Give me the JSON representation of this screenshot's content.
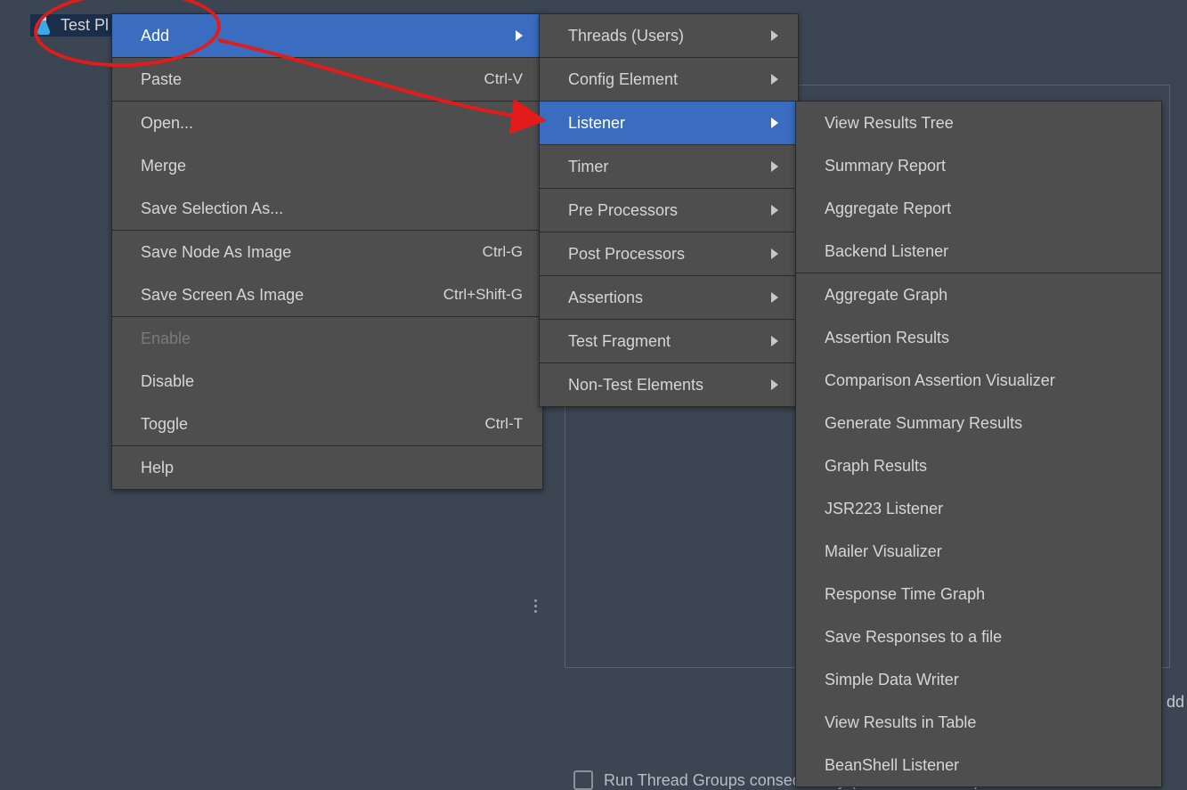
{
  "tree": {
    "item_label": "Test Pl"
  },
  "menu_main": [
    {
      "label": "Add",
      "shortcut": "",
      "submenu": true,
      "selected": true
    },
    {
      "sep": true
    },
    {
      "label": "Paste",
      "shortcut": "Ctrl-V"
    },
    {
      "sep": true
    },
    {
      "label": "Open..."
    },
    {
      "label": "Merge"
    },
    {
      "label": "Save Selection As..."
    },
    {
      "sep": true
    },
    {
      "label": "Save Node As Image",
      "shortcut": "Ctrl-G"
    },
    {
      "label": "Save Screen As Image",
      "shortcut": "Ctrl+Shift-G"
    },
    {
      "sep": true
    },
    {
      "label": "Enable",
      "disabled": true
    },
    {
      "label": "Disable"
    },
    {
      "label": "Toggle",
      "shortcut": "Ctrl-T"
    },
    {
      "sep": true
    },
    {
      "label": "Help"
    }
  ],
  "menu_add": [
    {
      "label": "Threads (Users)",
      "submenu": true
    },
    {
      "sep": true
    },
    {
      "label": "Config Element",
      "submenu": true
    },
    {
      "sep": true
    },
    {
      "label": "Listener",
      "submenu": true,
      "selected": true
    },
    {
      "sep": true
    },
    {
      "label": "Timer",
      "submenu": true
    },
    {
      "sep": true
    },
    {
      "label": "Pre Processors",
      "submenu": true
    },
    {
      "sep": true
    },
    {
      "label": "Post Processors",
      "submenu": true
    },
    {
      "sep": true
    },
    {
      "label": "Assertions",
      "submenu": true
    },
    {
      "sep": true
    },
    {
      "label": "Test Fragment",
      "submenu": true
    },
    {
      "sep": true
    },
    {
      "label": "Non-Test Elements",
      "submenu": true
    }
  ],
  "menu_listener": [
    {
      "label": "View Results Tree"
    },
    {
      "label": "Summary Report"
    },
    {
      "label": "Aggregate Report"
    },
    {
      "label": "Backend Listener"
    },
    {
      "sep": true
    },
    {
      "label": "Aggregate Graph"
    },
    {
      "label": "Assertion Results"
    },
    {
      "label": "Comparison Assertion Visualizer"
    },
    {
      "label": "Generate Summary Results"
    },
    {
      "label": "Graph Results"
    },
    {
      "label": "JSR223 Listener"
    },
    {
      "label": "Mailer Visualizer"
    },
    {
      "label": "Response Time Graph"
    },
    {
      "label": "Save Responses to a file"
    },
    {
      "label": "Simple Data Writer"
    },
    {
      "label": "View Results in Table"
    },
    {
      "label": "BeanShell Listener"
    }
  ],
  "footer": {
    "run_label": "Run Thread Groups consecutively (i.e. one at a time)"
  },
  "partial_text": {
    "add_snippet": "dd"
  }
}
